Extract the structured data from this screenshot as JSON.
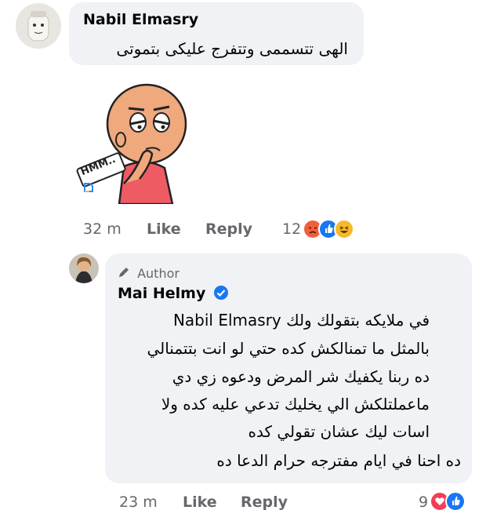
{
  "comment1": {
    "author": "Nabil Elmasry",
    "text": "الهى تتسممى وتتفرج عليكى بتموتى",
    "sticker_text": "HMM..",
    "time": "32 m",
    "like": "Like",
    "reply": "Reply",
    "reaction_count": "12",
    "reactions": [
      "angry-icon",
      "like-icon",
      "haha-icon"
    ]
  },
  "comment2": {
    "badge": "Author",
    "author": "Mai Helmy",
    "verified": true,
    "lines": [
      "في ملايكه بتقولك ولك Nabil Elmasry",
      "بالمثل ما تمنالكش كده حتي لو انت بتتمنالي",
      "ده ربنا يكفيك شر المرض ودعوه زي دي",
      "ماعملتلكش الي يخليك تدعي عليه كده ولا",
      "اسات ليك عشان تقولي كده",
      "ده احنا في ايام مفترجه حرام الدعا ده"
    ],
    "time": "23 m",
    "like": "Like",
    "reply": "Reply",
    "reaction_count": "9",
    "reactions": [
      "love-icon",
      "like-icon"
    ]
  },
  "colors": {
    "bubble": "#f0f2f5",
    "meta": "#65676b",
    "like_blue": "#1877f2",
    "love_red": "#f33e58",
    "angry": "#f0603c",
    "haha": "#f7b928"
  }
}
